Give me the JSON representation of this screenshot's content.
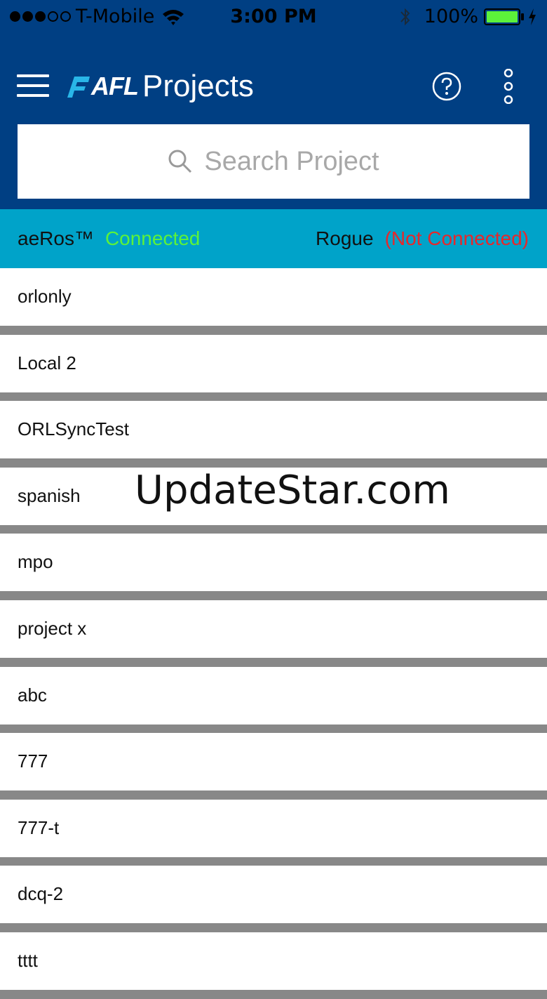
{
  "status_bar": {
    "carrier": "T-Mobile",
    "time": "3:00 PM",
    "battery": "100%"
  },
  "header": {
    "logo_afl": "AFL",
    "logo_projects": "Projects",
    "icons": [
      "menu-icon",
      "help-icon",
      "more-vertical-icon"
    ]
  },
  "search": {
    "placeholder": "Search Project"
  },
  "connections": {
    "device1_name": "aeRos™",
    "device1_status": "Connected",
    "device2_name": "Rogue",
    "device2_status": "(Not Connected)",
    "colors": {
      "connected": "#5cf23a",
      "not_connected": "#e8272a"
    }
  },
  "projects": [
    "orlonly",
    "Local 2",
    "ORLSyncTest",
    "spanish",
    "mpo",
    "project x",
    "abc",
    "777",
    "777-t",
    "dcq-2",
    "tttt"
  ],
  "watermark": "UpdateStar.com",
  "colors": {
    "header_bg": "#003f83",
    "connection_bar_bg": "#00a3c9",
    "list_separator": "#888888"
  }
}
